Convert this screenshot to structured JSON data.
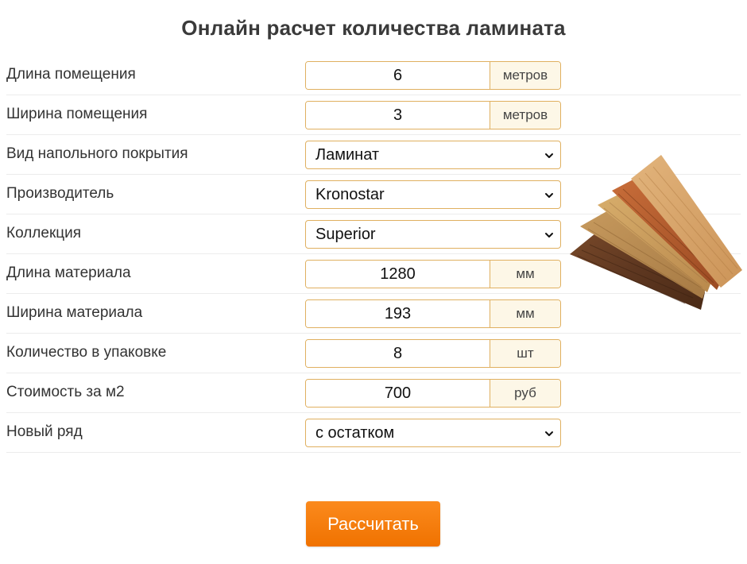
{
  "title": "Онлайн расчет количества ламината",
  "rows": [
    {
      "label": "Длина помещения",
      "value": "6",
      "unit": "метров"
    },
    {
      "label": "Ширина помещения",
      "value": "3",
      "unit": "метров"
    },
    {
      "label": "Вид напольного покрытия",
      "selected": "Ламинат"
    },
    {
      "label": "Производитель",
      "selected": "Kronostar"
    },
    {
      "label": "Коллекция",
      "selected": "Superior"
    },
    {
      "label": "Длина материала",
      "value": "1280",
      "unit": "мм"
    },
    {
      "label": "Ширина материала",
      "value": "193",
      "unit": "мм"
    },
    {
      "label": "Количество в упаковке",
      "value": "8",
      "unit": "шт"
    },
    {
      "label": "Стоимость за м2",
      "value": "700",
      "unit": "руб"
    },
    {
      "label": "Новый ряд",
      "selected": "с остатком"
    }
  ],
  "button": {
    "label": "Рассчитать"
  },
  "colors": {
    "accent": "#f57c00",
    "field_border": "#e0b060",
    "unit_background": "#fdf7e7"
  },
  "icons": {
    "select_arrow": "chevron-down-icon",
    "image": "laminate-samples-image"
  }
}
